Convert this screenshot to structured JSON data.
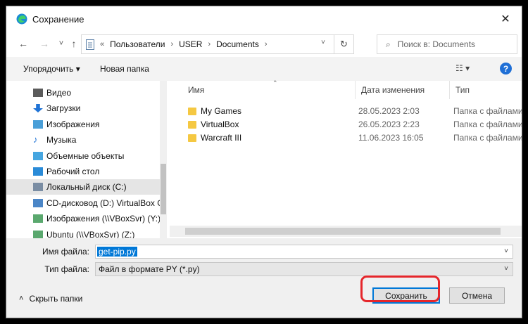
{
  "window": {
    "title": "Сохранение",
    "close": "✕"
  },
  "nav": {
    "back": "←",
    "forward": "→",
    "down": "˅",
    "up": "↑"
  },
  "address": {
    "prefix": "«",
    "crumbs": [
      "Пользователи",
      "USER",
      "Documents"
    ],
    "sep": "›",
    "refresh": "↻",
    "dd": "˅"
  },
  "search": {
    "placeholder": "Поиск в: Documents",
    "icon": "⌕"
  },
  "toolbar": {
    "organize": "Упорядочить ▾",
    "new_folder": "Новая папка",
    "view": "☷ ▾",
    "help": "?"
  },
  "sidebar": {
    "items": [
      {
        "label": "Видео",
        "icon": "video-icon",
        "color": "#5b5b5b"
      },
      {
        "label": "Загрузки",
        "icon": "downloads-icon",
        "color": "#1f73d6"
      },
      {
        "label": "Изображения",
        "icon": "pictures-icon",
        "color": "#4a9fd8"
      },
      {
        "label": "Музыка",
        "icon": "music-icon",
        "color": "#1f73d6"
      },
      {
        "label": "Объемные объекты",
        "icon": "3d-objects-icon",
        "color": "#46a6e0"
      },
      {
        "label": "Рабочий стол",
        "icon": "desktop-icon",
        "color": "#2a8bd8"
      },
      {
        "label": "Локальный диск (C:)",
        "icon": "drive-icon",
        "color": "#7a8da3"
      },
      {
        "label": "CD-дисковод (D:) VirtualBox Gu",
        "icon": "cd-drive-icon",
        "color": "#4b86c7"
      },
      {
        "label": "Изображения (\\\\VBoxSvr) (Y:)",
        "icon": "network-drive-icon",
        "color": "#5aa86e"
      },
      {
        "label": "Ubuntu (\\\\VBoxSvr) (Z:)",
        "icon": "network-drive-icon",
        "color": "#5aa86e"
      }
    ]
  },
  "files": {
    "headers": {
      "name": "Имя",
      "date": "Дата изменения",
      "type": "Тип"
    },
    "rows": [
      {
        "name": "My Games",
        "date": "28.05.2023 2:03",
        "type": "Папка с файлами"
      },
      {
        "name": "VirtualBox",
        "date": "26.05.2023 2:23",
        "type": "Папка с файлами"
      },
      {
        "name": "Warcraft III",
        "date": "11.06.2023 16:05",
        "type": "Папка с файлами"
      }
    ]
  },
  "form": {
    "filename_label": "Имя файла:",
    "filename_value": "get-pip.py",
    "filetype_label": "Тип файла:",
    "filetype_value": "Файл в формате PY (*.py)",
    "dd": "˅"
  },
  "footer": {
    "hide_folders": "Скрыть папки",
    "hide_icon": "˄",
    "save": "Сохранить",
    "cancel": "Отмена"
  },
  "colors": {
    "accent": "#0078d7",
    "highlight_red": "#e5262b",
    "folder": "#f5c842"
  }
}
